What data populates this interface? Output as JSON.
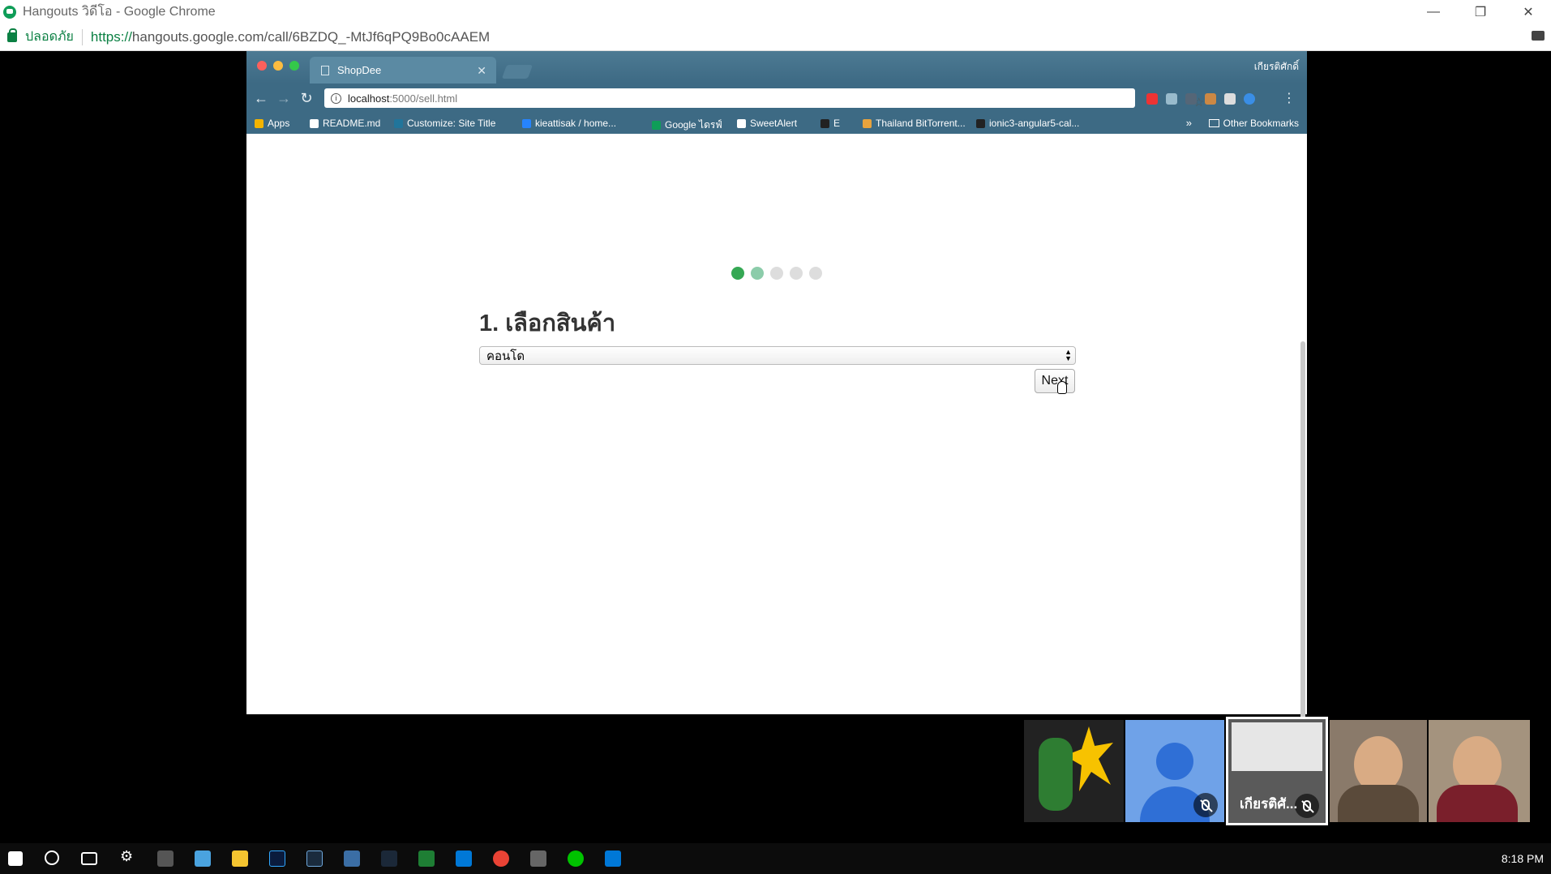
{
  "window": {
    "title": "Hangouts วิดีโอ - Google Chrome",
    "secure_label": "ปลอดภัย",
    "url_scheme": "https://",
    "url_rest": "hangouts.google.com/call/6BZDQ_-MtJf6qPQ9Bo0cAAEM"
  },
  "inner_browser": {
    "tab_title": "ShopDee",
    "profile": "เกียรติศักดิ์",
    "omnibox_host": "localhost",
    "omnibox_path": ":5000/sell.html",
    "bookmarks": [
      {
        "label": "Apps",
        "icon": "apps-grid-icon",
        "color": "#f4b400"
      },
      {
        "label": "README.md",
        "icon": "document-icon",
        "color": "#ffffff"
      },
      {
        "label": "Customize: Site Title",
        "icon": "wordpress-icon",
        "color": "#21759b"
      },
      {
        "label": "kieattisak / home...",
        "icon": "bitbucket-icon",
        "color": "#2684ff"
      },
      {
        "label": "Google ไดรฟ์",
        "icon": "google-drive-icon",
        "color": "#0f9d58"
      },
      {
        "label": "SweetAlert",
        "icon": "document-icon",
        "color": "#ffffff"
      },
      {
        "label": "E",
        "icon": "github-icon",
        "color": "#222222"
      },
      {
        "label": "Thailand BitTorrent...",
        "icon": "torrent-icon",
        "color": "#e8a33d"
      },
      {
        "label": "ionic3-angular5-cal...",
        "icon": "github-icon",
        "color": "#222222"
      }
    ],
    "bookmarks_more": "»",
    "other_bookmarks": "Other Bookmarks"
  },
  "page": {
    "steps": {
      "total": 5,
      "current": 1,
      "colors": [
        "#35a854",
        "#8cccaa",
        "#dddddd",
        "#dddddd",
        "#dddddd"
      ]
    },
    "heading": "1. เลือกสินค้า",
    "select_value": "คอนโด",
    "next_label": "Next"
  },
  "participants": [
    {
      "name": "",
      "muted": false,
      "bg": "#222222"
    },
    {
      "name": "",
      "muted": true,
      "bg": "#6fa2e8"
    },
    {
      "name": "เกียรติศั...",
      "muted": true,
      "bg": "#5a5a5a"
    },
    {
      "name": "",
      "muted": false,
      "bg": "#8a7a6a"
    },
    {
      "name": "",
      "muted": false,
      "bg": "#a4937e"
    }
  ],
  "taskbar": {
    "clock": "8:18 PM"
  }
}
